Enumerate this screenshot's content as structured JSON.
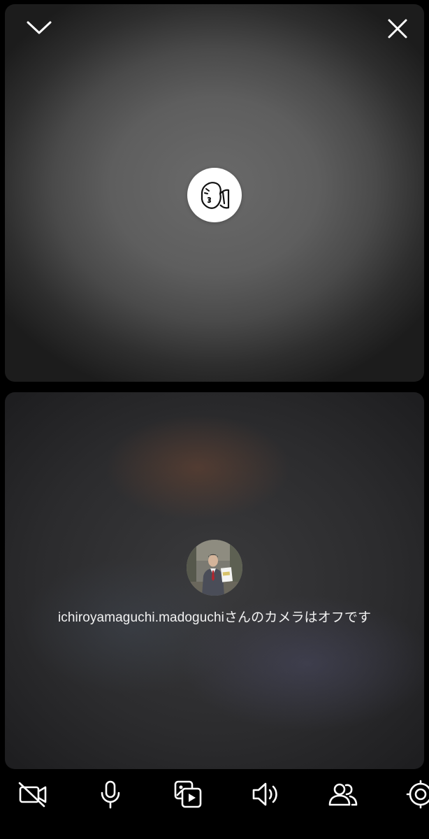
{
  "call": {
    "participant_name": "ichiroyamaguchi.madoguchi",
    "camera_off_message": "ichiroyamaguchi.madoguchiさんのカメラはオフです"
  },
  "controls": {
    "top": [
      {
        "id": "minimize",
        "icon": "chevron-down-icon"
      },
      {
        "id": "end",
        "icon": "close-icon"
      }
    ],
    "toolbar": [
      {
        "id": "camera",
        "icon": "video-off-icon"
      },
      {
        "id": "microphone",
        "icon": "microphone-icon"
      },
      {
        "id": "share-media",
        "icon": "media-share-icon"
      },
      {
        "id": "speaker",
        "icon": "speaker-icon"
      },
      {
        "id": "participants",
        "icon": "people-icon"
      },
      {
        "id": "effects",
        "icon": "effects-icon"
      }
    ]
  },
  "colors": {
    "background": "#000000",
    "icon": "#ffffff",
    "text": "#f2f2f2"
  }
}
